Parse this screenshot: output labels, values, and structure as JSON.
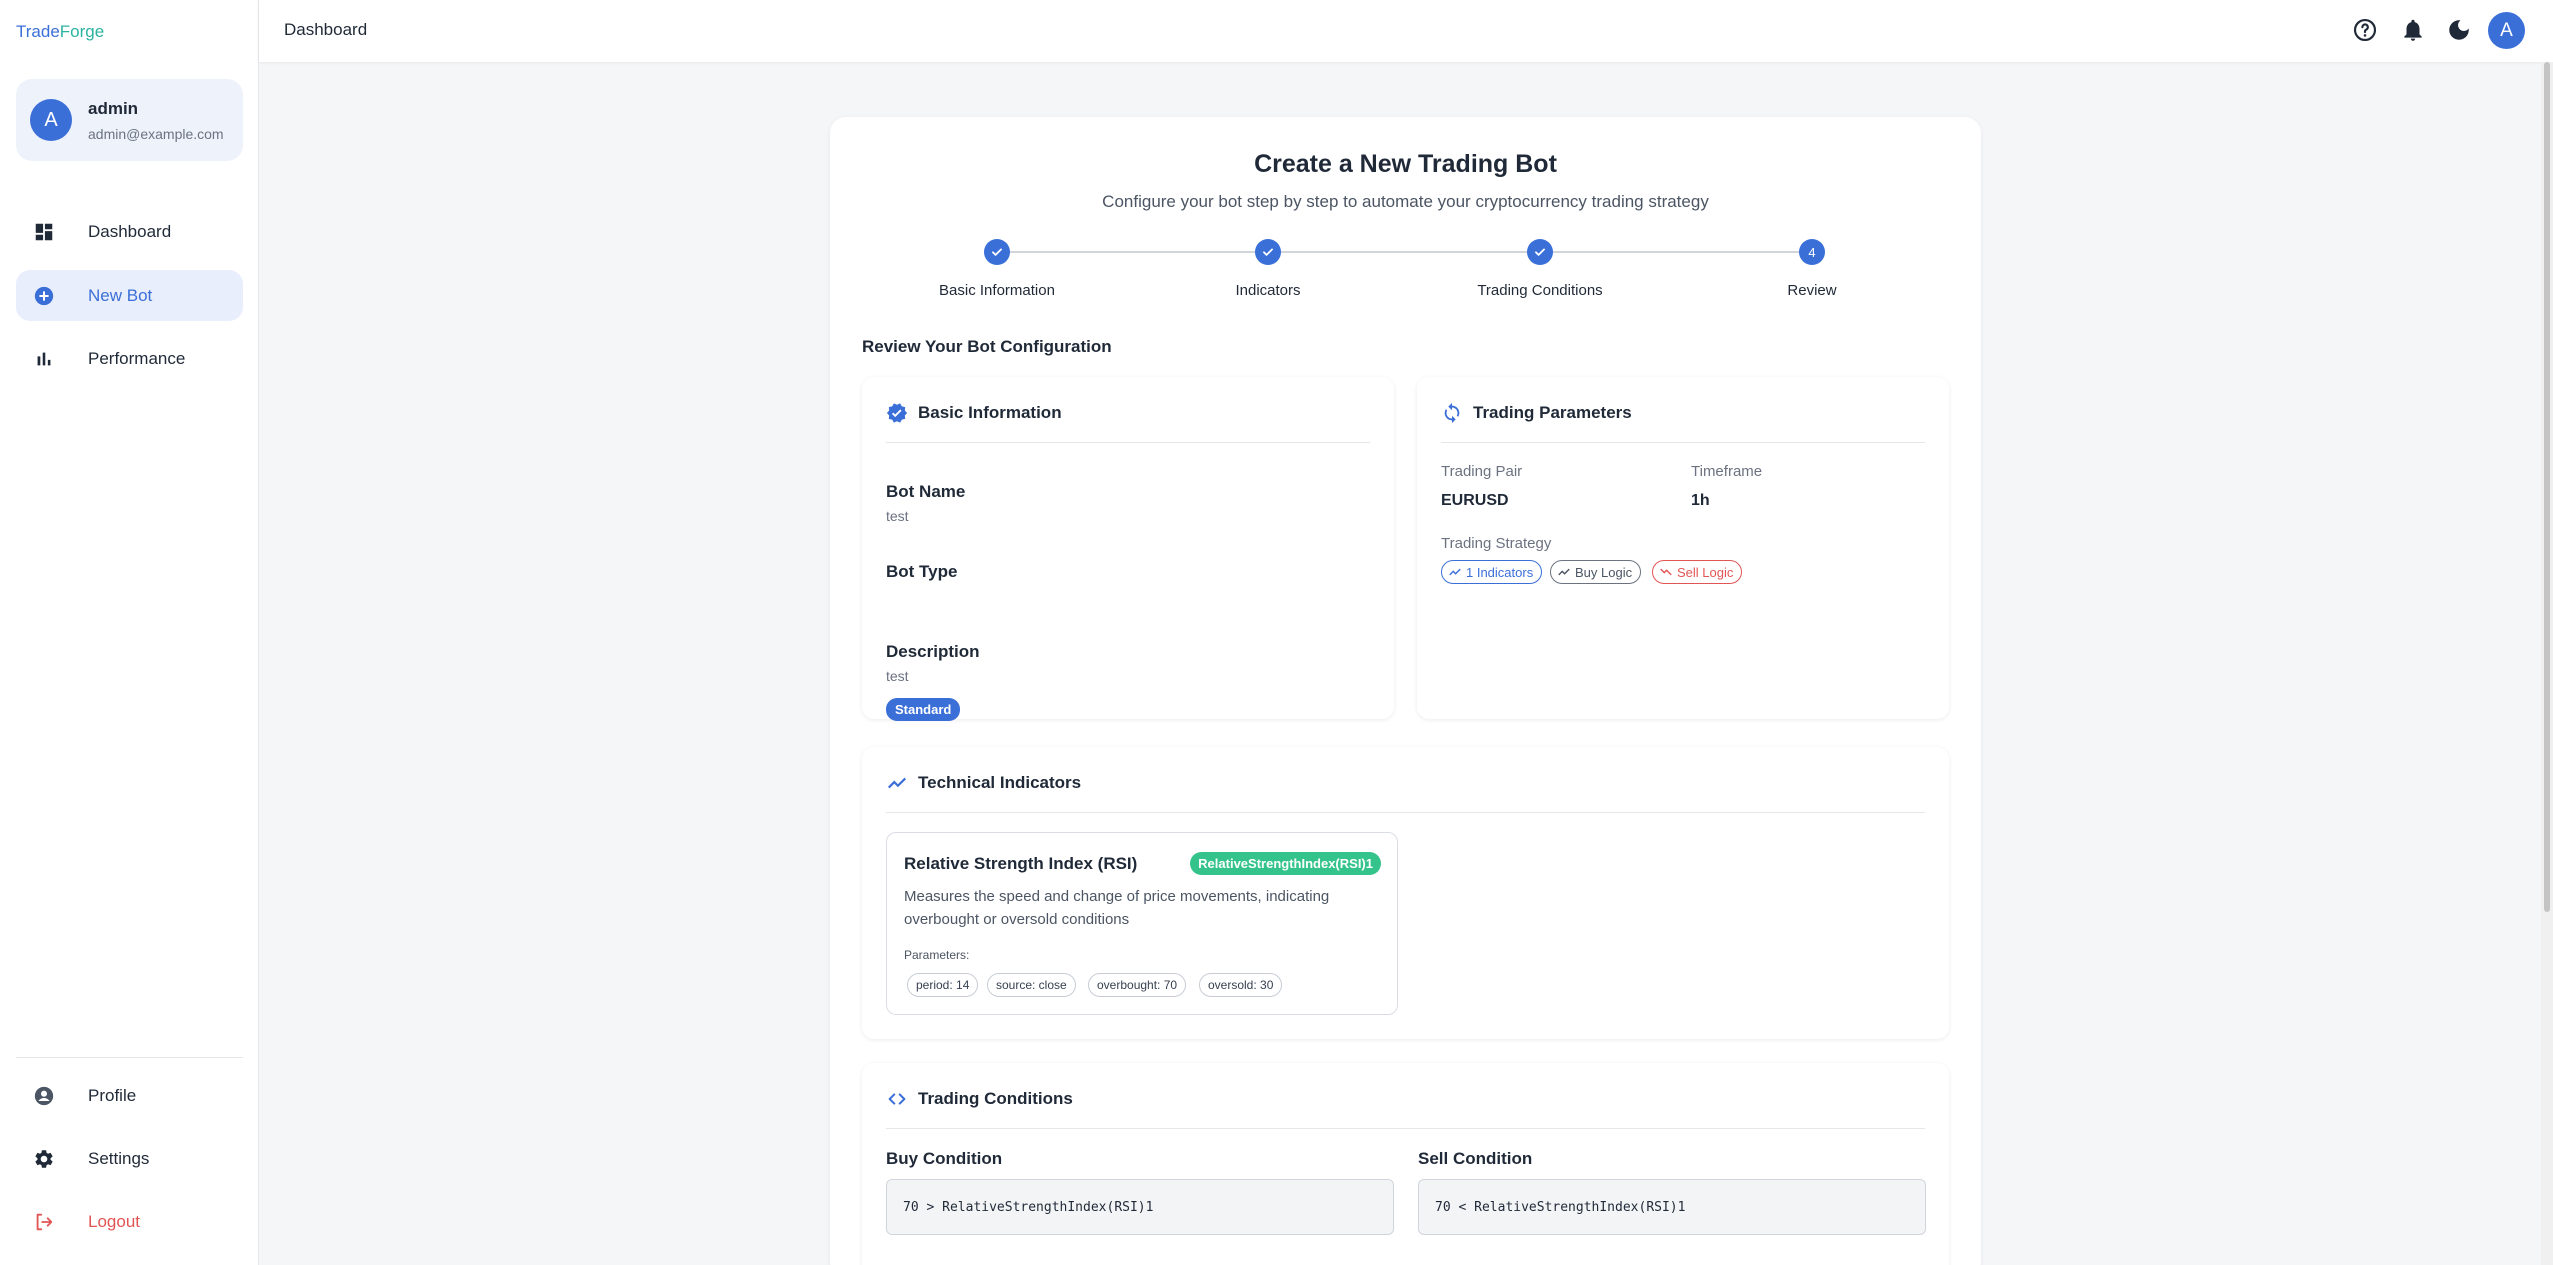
{
  "brand": {
    "part1": "Trade",
    "part2": "Forge"
  },
  "user": {
    "initial": "A",
    "name": "admin",
    "email": "admin@example.com"
  },
  "nav": {
    "dashboard": "Dashboard",
    "new_bot": "New Bot",
    "performance": "Performance",
    "profile": "Profile",
    "settings": "Settings",
    "logout": "Logout"
  },
  "topbar": {
    "title": "Dashboard",
    "avatar_initial": "A"
  },
  "page": {
    "title": "Create a New Trading Bot",
    "subtitle": "Configure your bot step by step to automate your cryptocurrency trading strategy",
    "review_title": "Review Your Bot Configuration"
  },
  "steps": [
    {
      "label": "Basic Information",
      "state": "complete"
    },
    {
      "label": "Indicators",
      "state": "complete"
    },
    {
      "label": "Trading Conditions",
      "state": "complete"
    },
    {
      "label": "Review",
      "state": "current",
      "number": "4"
    }
  ],
  "basic_info": {
    "title": "Basic Information",
    "bot_name_label": "Bot Name",
    "bot_name": "test",
    "bot_type_label": "Bot Type",
    "bot_type": "Standard",
    "description_label": "Description",
    "description": "test"
  },
  "trading_params": {
    "title": "Trading Parameters",
    "pair_label": "Trading Pair",
    "pair": "EURUSD",
    "timeframe_label": "Timeframe",
    "timeframe": "1h",
    "strategy_label": "Trading Strategy",
    "chips": {
      "indicators": "1 Indicators",
      "buy": "Buy Logic",
      "sell": "Sell Logic"
    }
  },
  "technical_indicators": {
    "title": "Technical Indicators",
    "indicator": {
      "name": "Relative Strength Index (RSI)",
      "tag": "RelativeStrengthIndex(RSI)1",
      "description": "Measures the speed and change of price movements, indicating overbought or oversold conditions",
      "params_label": "Parameters:",
      "params": [
        "period: 14",
        "source: close",
        "overbought: 70",
        "oversold: 30"
      ]
    }
  },
  "trading_conditions": {
    "title": "Trading Conditions",
    "buy_label": "Buy Condition",
    "buy": "70 > RelativeStrengthIndex(RSI)1",
    "sell_label": "Sell Condition",
    "sell": "70 < RelativeStrengthIndex(RSI)1"
  },
  "colors": {
    "primary": "#3b6fd8",
    "accent": "#2bb3a0",
    "success": "#34c48b",
    "danger": "#e25555"
  }
}
